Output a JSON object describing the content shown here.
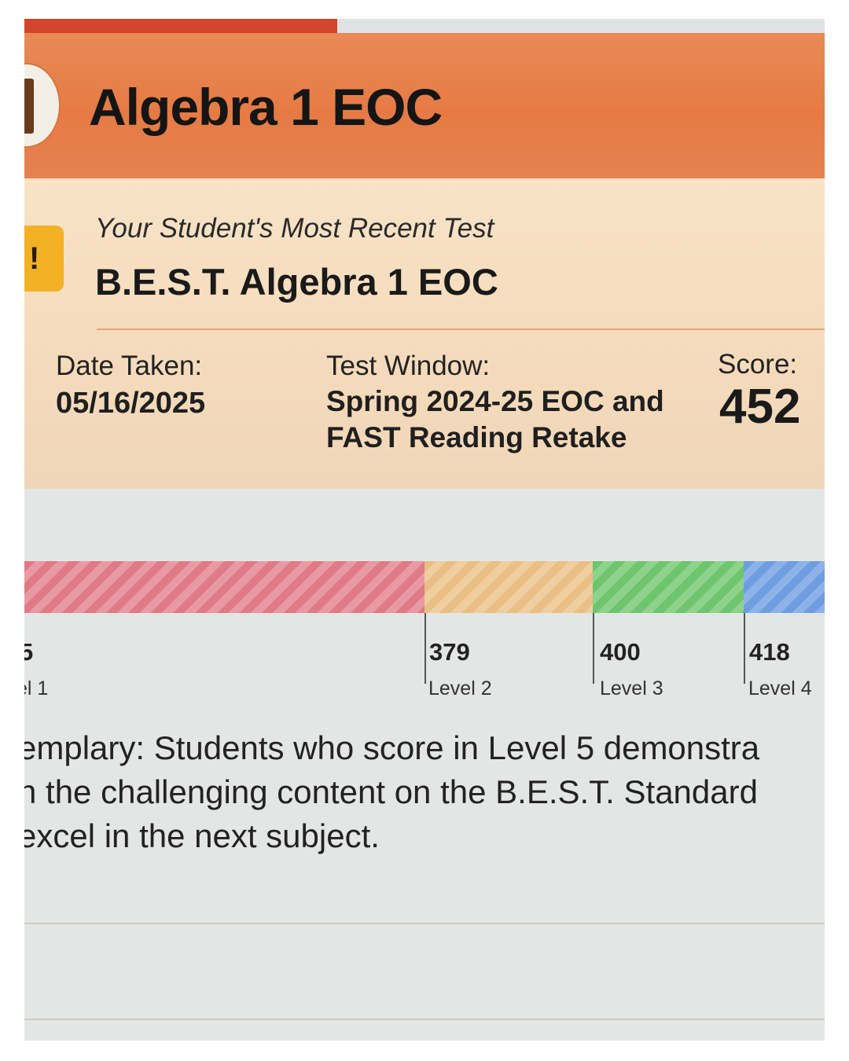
{
  "header": {
    "title": "Algebra 1 EOC"
  },
  "recent_test": {
    "badge": "!",
    "subtitle": "Your Student's Most Recent Test",
    "test_name": "B.E.S.T. Algebra 1 EOC"
  },
  "details": {
    "date_label": "Date Taken:",
    "date_value": "05/16/2025",
    "window_label": "Test Window:",
    "window_line1": "Spring 2024-25 EOC and",
    "window_line2": "FAST Reading Retake",
    "score_label": "Score:",
    "score_value": "452"
  },
  "scale": {
    "colors": {
      "level1": "#e07a86",
      "level2": "#e9bf86",
      "level3": "#6fc46e",
      "level4": "#6e9de0"
    },
    "level1_cut_partial": "5",
    "level1_name_partial": "el 1",
    "level2_cut": "379",
    "level2_name": "Level 2",
    "level3_cut": "400",
    "level3_name": "Level 3",
    "level4_cut": "418",
    "level4_name": "Level 4"
  },
  "description": {
    "line1": "emplary: Students who score in Level 5 demonstra",
    "line2": "h the challenging content on the B.E.S.T. Standard",
    "line3": "excel in the next subject."
  }
}
